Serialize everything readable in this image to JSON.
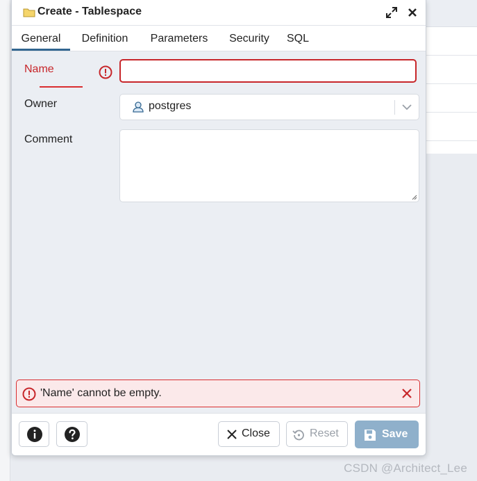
{
  "dialog": {
    "title": "Create - Tablespace",
    "tabs": [
      {
        "label": "General",
        "active": true
      },
      {
        "label": "Definition"
      },
      {
        "label": "Parameters"
      },
      {
        "label": "Security"
      },
      {
        "label": "SQL"
      }
    ]
  },
  "form": {
    "name_label": "Name",
    "name_value": "",
    "owner_label": "Owner",
    "owner_value": "postgres",
    "comment_label": "Comment",
    "comment_value": ""
  },
  "error": {
    "message": "'Name' cannot be empty."
  },
  "footer": {
    "close_label": "Close",
    "reset_label": "Reset",
    "save_label": "Save"
  },
  "watermark": "CSDN @Architect_Lee",
  "colors": {
    "error": "#c7262a",
    "accent": "#326690",
    "save_disabled": "#8fb0cb"
  },
  "icons": [
    "folder-icon",
    "expand-icon",
    "close-icon",
    "error-icon",
    "user-icon",
    "chevron-down-icon",
    "info-icon",
    "help-icon",
    "reset-icon",
    "save-icon"
  ]
}
